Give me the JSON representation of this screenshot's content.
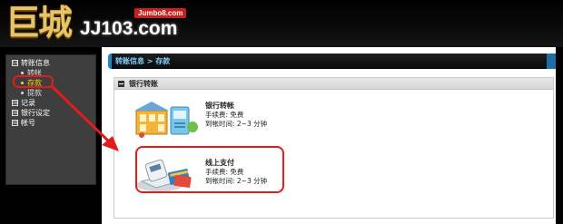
{
  "header": {
    "logo_cn": "巨城",
    "logo_en": "JJ103.com",
    "logo_domain": "Jumbo8.com"
  },
  "sidebar": {
    "groups": [
      {
        "toggle": "⊟",
        "label": "转账信息",
        "children": [
          "转帐",
          "存款",
          "提款"
        ]
      },
      {
        "toggle": "⊞",
        "label": "记录"
      },
      {
        "toggle": "⊞",
        "label": "银行设定"
      },
      {
        "toggle": "⊞",
        "label": "帐号"
      }
    ],
    "active_child": "存款"
  },
  "breadcrumb": {
    "text": "转账信息 > 存款"
  },
  "section": {
    "title": "银行转账",
    "options": [
      {
        "title": "银行转帐",
        "fee": "手续费: 免费",
        "time": "到帐时间: 2~3 分钟",
        "icon": "bank-building-icon"
      },
      {
        "title": "线上支付",
        "fee": "手续费: 免费",
        "time": "到帐时间: 2~3 分钟",
        "icon": "card-reader-icon"
      }
    ]
  },
  "colors": {
    "highlight": "#e31b1b",
    "active": "#ffd400",
    "accent": "#1f86c8"
  }
}
